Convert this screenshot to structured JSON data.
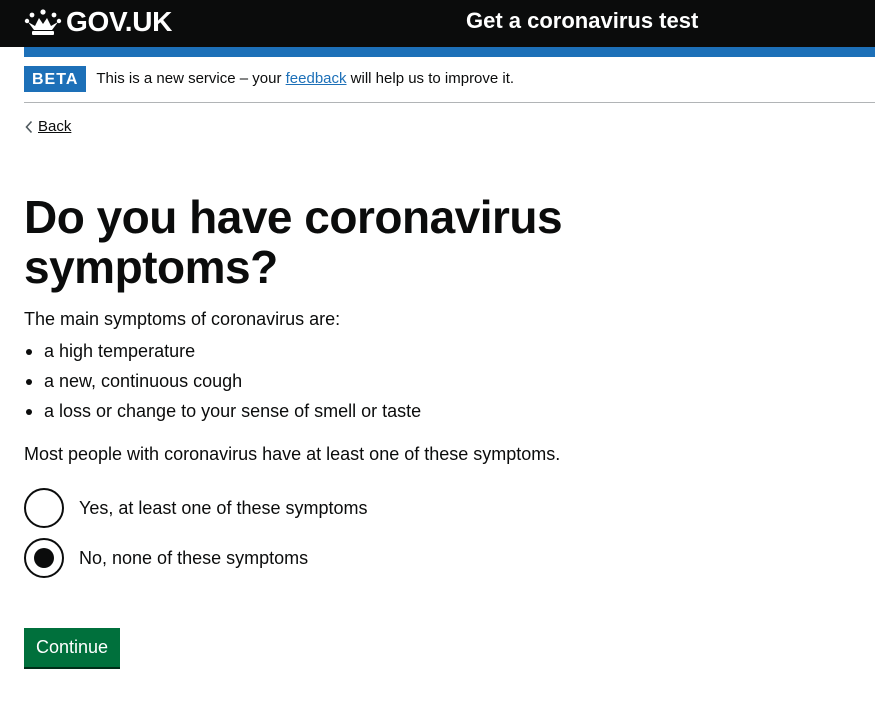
{
  "header": {
    "logo_text": "GOV.UK",
    "service_name": "Get a coronavirus test"
  },
  "phase_banner": {
    "tag": "BETA",
    "text_before": "This is a new service – your ",
    "link_text": "feedback",
    "text_after": " will help us to improve it."
  },
  "back_link": "Back",
  "heading": "Do you have coronavirus symptoms?",
  "intro": "The main symptoms of coronavirus are:",
  "symptoms": [
    "a high temperature",
    "a new, continuous cough",
    "a loss or change to your sense of smell or taste"
  ],
  "most_people": "Most people with coronavirus have at least one of these symptoms.",
  "options": [
    {
      "label": "Yes, at least one of these symptoms",
      "selected": false
    },
    {
      "label": "No, none of these symptoms",
      "selected": true
    }
  ],
  "continue_label": "Continue",
  "colors": {
    "header_bg": "#0b0c0c",
    "brand_blue": "#1d70b8",
    "button_green": "#00703c"
  },
  "icons": {
    "logo": "crown-icon",
    "back": "chevron-left-icon"
  }
}
